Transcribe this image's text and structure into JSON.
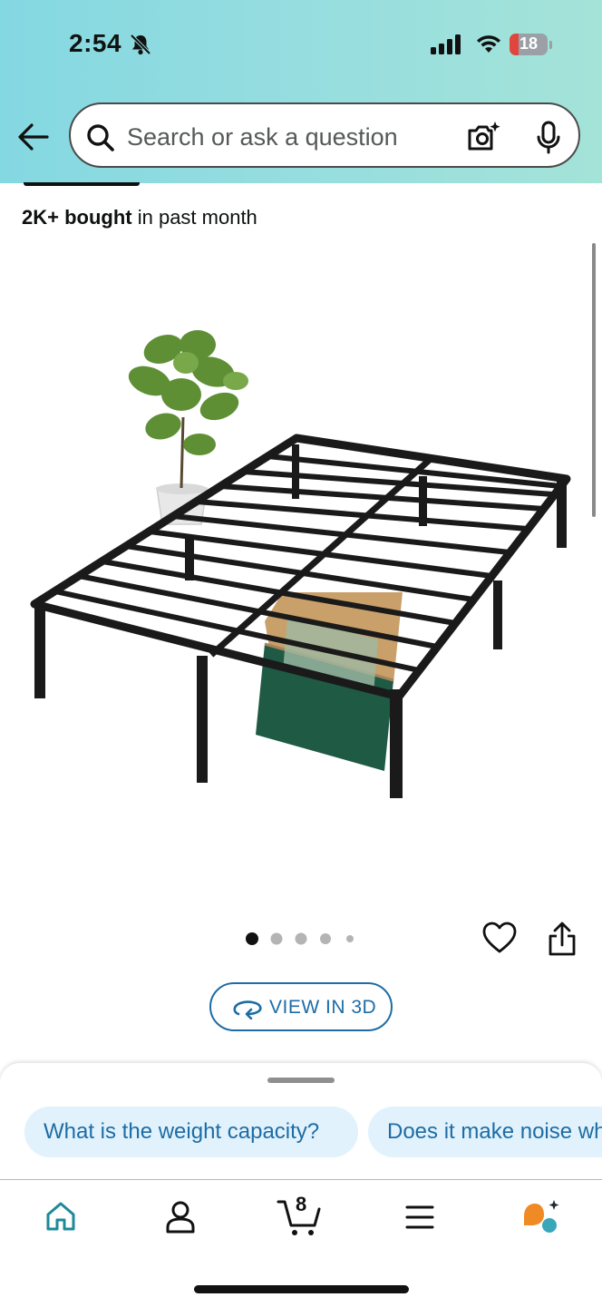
{
  "status_bar": {
    "time": "2:54",
    "battery_level": "18",
    "icons": [
      "bell-off-icon",
      "signal-icon",
      "wifi-icon",
      "battery-icon"
    ]
  },
  "search": {
    "placeholder": "Search or ask a question",
    "icons": [
      "back-arrow-icon",
      "search-icon",
      "camera-lens-icon",
      "microphone-icon"
    ]
  },
  "product": {
    "bought_bold": "2K+ bought",
    "bought_rest": " in past month",
    "image_description_icon": "bed-frame-image",
    "image_count": 5,
    "active_image_index": 0,
    "view_3d_label": "VIEW IN 3D"
  },
  "suggestions": [
    "What is the weight capacity?",
    "Does it make noise when moving?"
  ],
  "bottom_nav": {
    "items": [
      "home-icon",
      "account-icon",
      "cart-icon",
      "menu-icon",
      "rufus-icon"
    ],
    "cart_count": "8"
  },
  "colors": {
    "header_gradient_start": "#84d8e1",
    "header_gradient_end": "#a4e3d8",
    "link_blue": "#1d6ca5",
    "chip_bg": "#e1f2fc",
    "home_teal": "#1d8a99",
    "rufus_orange": "#f08a24",
    "rufus_teal": "#3aa6b9"
  }
}
